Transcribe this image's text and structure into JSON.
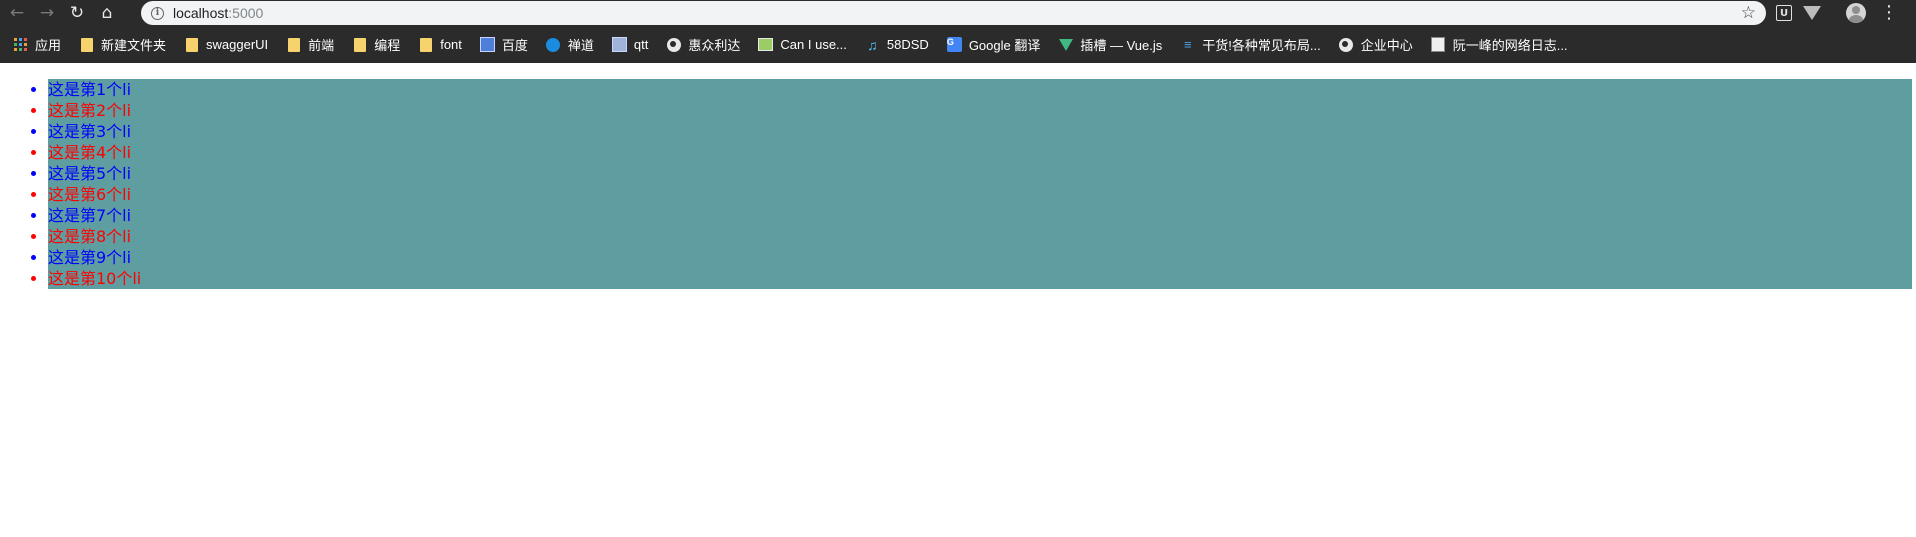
{
  "browser": {
    "url_host": "localhost",
    "url_port": ":5000",
    "icons": {
      "back": "back-arrow-icon",
      "forward": "forward-arrow-icon",
      "reload": "reload-icon",
      "home": "home-icon",
      "info": "info-icon",
      "star": "star-icon",
      "menu": "kebab-menu-icon"
    }
  },
  "bookmarks": [
    {
      "label": "应用",
      "icon": "apps-grid-icon"
    },
    {
      "label": "新建文件夹",
      "icon": "folder-icon"
    },
    {
      "label": "swaggerUI",
      "icon": "folder-icon"
    },
    {
      "label": "前端",
      "icon": "folder-icon"
    },
    {
      "label": "编程",
      "icon": "folder-icon"
    },
    {
      "label": "font",
      "icon": "folder-icon"
    },
    {
      "label": "百度",
      "icon": "baidu-icon"
    },
    {
      "label": "禅道",
      "icon": "zentao-icon"
    },
    {
      "label": "qtt",
      "icon": "qtt-icon"
    },
    {
      "label": "惠众利达",
      "icon": "globe-icon"
    },
    {
      "label": "Can I use...",
      "icon": "caniuse-icon"
    },
    {
      "label": "58DSD",
      "icon": "music-note-icon"
    },
    {
      "label": "Google 翻译",
      "icon": "google-translate-icon"
    },
    {
      "label": "插槽 — Vue.js",
      "icon": "vue-icon"
    },
    {
      "label": "干货!各种常见布局...",
      "icon": "layers-icon"
    },
    {
      "label": "企业中心",
      "icon": "globe-icon"
    },
    {
      "label": "阮一峰的网络日志...",
      "icon": "document-icon"
    }
  ],
  "list": {
    "items": [
      "这是第1个li",
      "这是第2个li",
      "这是第3个li",
      "这是第4个li",
      "这是第5个li",
      "这是第6个li",
      "这是第7个li",
      "这是第8个li",
      "这是第9个li",
      "这是第10个li"
    ],
    "colors": {
      "odd": "#0000ff",
      "even": "#ff0000",
      "background": "#5f9ea0"
    }
  }
}
